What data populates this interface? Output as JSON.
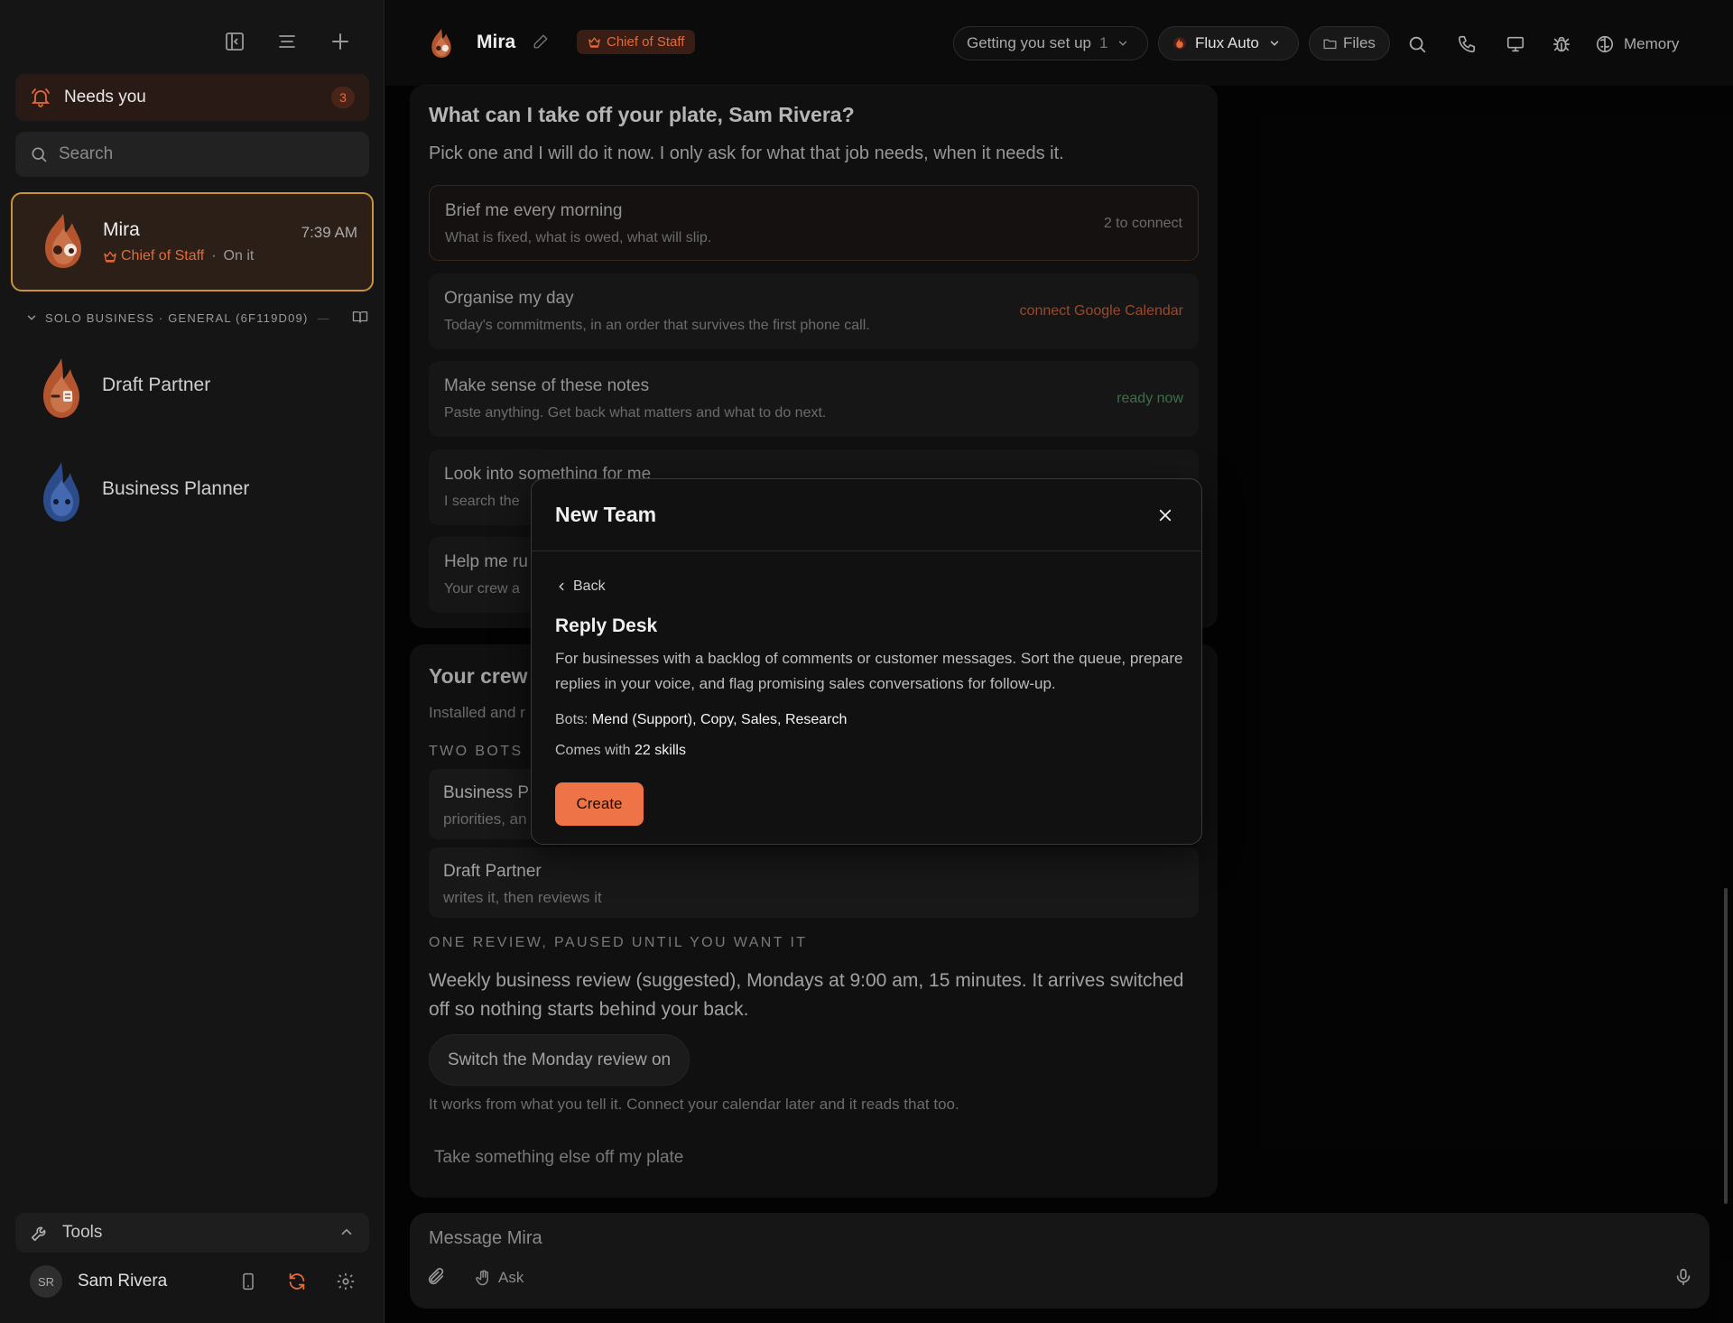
{
  "sidebar": {
    "icons": [
      "sidebar-toggle-icon",
      "menu-icon",
      "plus-icon"
    ],
    "needs_you": {
      "label": "Needs you",
      "count": "3"
    },
    "search": {
      "placeholder": "Search"
    },
    "active_agent": {
      "name": "Mira",
      "time": "7:39 AM",
      "role": "Chief of Staff",
      "separator": "·",
      "status": "On it"
    },
    "section": {
      "label": "SOLO BUSINESS · GENERAL (6F119D09)",
      "dash": "—"
    },
    "agents": [
      {
        "name": "Draft Partner"
      },
      {
        "name": "Business Planner"
      }
    ],
    "tools": {
      "label": "Tools"
    },
    "user": {
      "initials": "SR",
      "name": "Sam Rivera"
    }
  },
  "header": {
    "agent_name": "Mira",
    "role_badge": "Chief of Staff",
    "setup_label": "Getting you set up",
    "setup_count": "1",
    "model_label": "Flux Auto",
    "files_label": "Files",
    "memory_label": "Memory"
  },
  "card1": {
    "title": "What can I take off your plate, Sam Rivera?",
    "intro": "Pick one and I will do it now. I only ask for what that job needs, when it needs it.",
    "options": [
      {
        "title": "Brief me every morning",
        "desc": "What is fixed, what is owed, what will slip.",
        "status": "2 to connect"
      },
      {
        "title": "Organise my day",
        "desc": "Today's commitments, in an order that survives the first phone call.",
        "status": "connect Google Calendar"
      },
      {
        "title": "Make sense of these notes",
        "desc": "Paste anything. Get back what matters and what to do next.",
        "status": "ready now"
      },
      {
        "title": "Look into something for me",
        "desc": "I search the",
        "status": ""
      },
      {
        "title": "Help me ru",
        "desc": "Your crew a",
        "status": ""
      }
    ]
  },
  "card2": {
    "title": "Your crew",
    "installed": "Installed and r",
    "caption_bots": "TWO BOTS",
    "bots": [
      {
        "title": "Business P",
        "desc": "priorities, an"
      },
      {
        "title": "Draft Partner",
        "desc": "writes it, then reviews it"
      }
    ],
    "caption_review": "ONE REVIEW, PAUSED UNTIL YOU WANT IT",
    "weekly": "Weekly business review (suggested), Mondays at 9:00 am, 15 minutes. It arrives switched off so nothing starts behind your back.",
    "switch_button": "Switch the Monday review on",
    "works_note": "It works from what you tell it. Connect your calendar later and it reads that too.",
    "take_more": "Take something else off my plate"
  },
  "composer": {
    "placeholder": "Message Mira",
    "ask_label": "Ask"
  },
  "modal": {
    "title": "New Team",
    "back_label": "Back",
    "template_title": "Reply Desk",
    "description": "For businesses with a backlog of comments or customer messages. Sort the queue, prepare replies in your voice, and flag promising sales conversations for follow-up.",
    "bots_label": "Bots:",
    "bots_value": "Mend (Support), Copy, Sales, Research",
    "skills_prefix": "Comes with",
    "skills_value": "22 skills",
    "create_label": "Create"
  },
  "colors": {
    "accent": "#ee7447",
    "accent_text": "#e46a3c",
    "active_border": "#c9933c",
    "ready": "#4e8f5a",
    "background": "#050505",
    "sidebar": "#151515"
  }
}
